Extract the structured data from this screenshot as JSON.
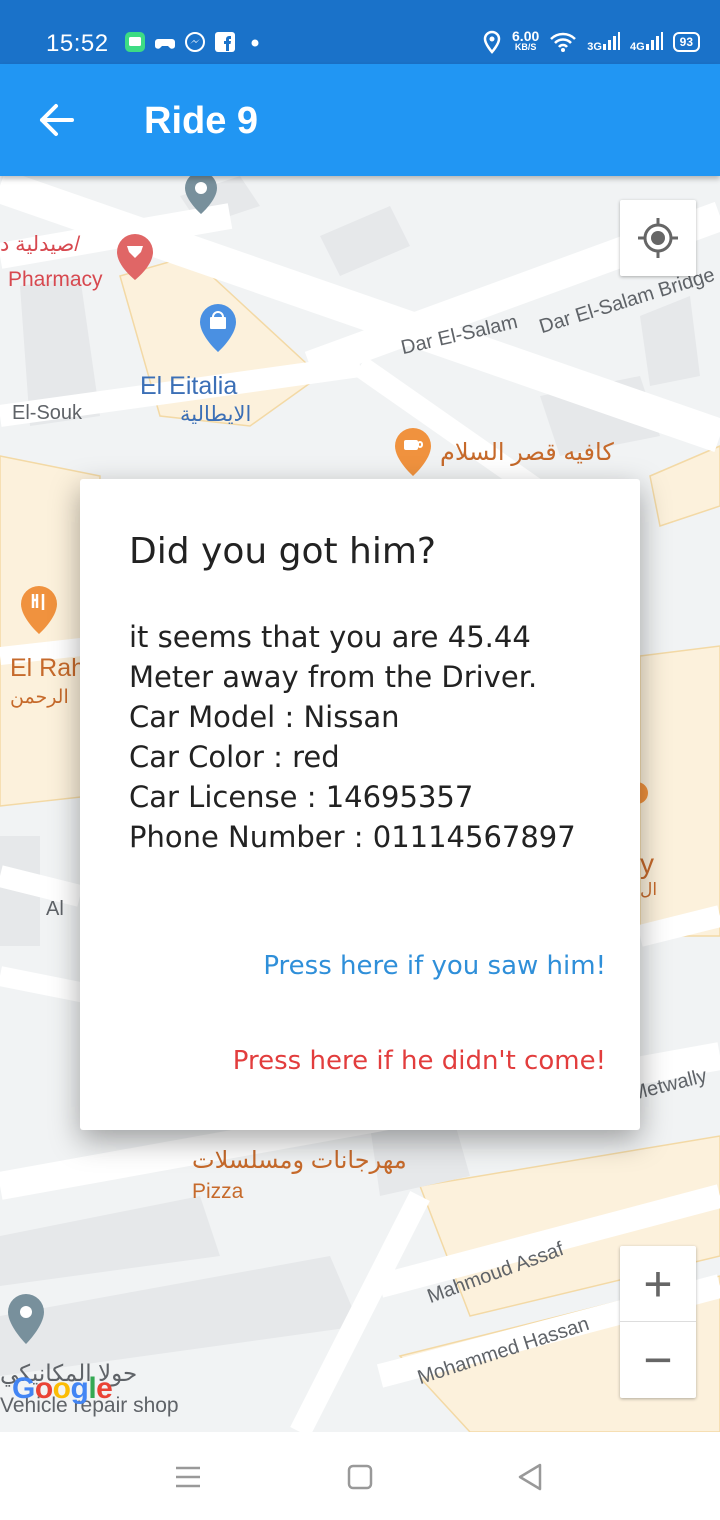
{
  "status_bar": {
    "time": "15:52",
    "net_speed_value": "6.00",
    "net_speed_unit": "KB/S",
    "sim1": "3G",
    "sim2": "4G",
    "battery": "93"
  },
  "app_bar": {
    "title": "Ride 9",
    "back_icon": "arrow-left-icon"
  },
  "map": {
    "pois": {
      "pharmacy_ar": "صيدلية د/",
      "pharmacy": "Pharmacy",
      "eitalia": "El Eitalia",
      "eitalia_ar": "الايطالية",
      "cafe_ar": "كافيه قصر السلام",
      "elrah": "El Rah",
      "elrah_ar": "الرحمن",
      "pizza_ar": "مهرجانات ومسلسلات",
      "pizza": "Pizza",
      "repair_ar": "حولا المكانيكي",
      "repair": "Vehicle repair shop",
      "right_y": "y",
      "right_ar": "ال",
      "left_al": "Al"
    },
    "streets": {
      "el_souk": "El-Souk",
      "dar_el_salam": "Dar El-Salam",
      "dar_el_salam_bridge": "Dar El-Salam Bridge",
      "metwally": "Metwally",
      "mahmoud_assaf": "Mahmoud Assaf",
      "mohammed_hassan": "Mohammed Hassan"
    },
    "controls": {
      "locate_icon": "my-location-icon",
      "zoom_in": "+",
      "zoom_out": "−"
    },
    "logo": "Google"
  },
  "dialog": {
    "title": "Did you got him?",
    "lines": [
      "it seems that you are 45.44",
      "Meter away from the Driver.",
      "Car Model : Nissan",
      "Car Color : red",
      "Car License : 14695357",
      "Phone Number : 01114567897"
    ],
    "saw_button": "Press here if you saw him!",
    "not_come_button": "Press here if he didn't come!"
  },
  "colors": {
    "status_bar": "#1a72c9",
    "app_bar": "#2196f3",
    "saw_button": "#2f8fd9",
    "not_come_button": "#e23d3d"
  },
  "nav_bar": {
    "menu_icon": "menu-lines-icon",
    "home_icon": "home-square-icon",
    "back_icon": "back-triangle-icon"
  }
}
